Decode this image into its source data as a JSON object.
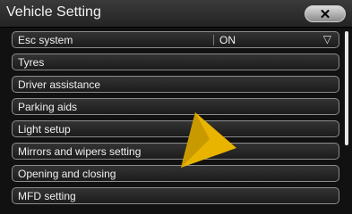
{
  "window": {
    "title": "Vehicle Setting",
    "close_symbol": "✕"
  },
  "esc": {
    "label": "Esc system",
    "value": "ON",
    "dropdown_symbol": "▽"
  },
  "items": [
    {
      "label": "Tyres"
    },
    {
      "label": "Driver assistance"
    },
    {
      "label": "Parking aids"
    },
    {
      "label": "Light setup"
    },
    {
      "label": "Mirrors and wipers setting"
    },
    {
      "label": "Opening and closing"
    },
    {
      "label": "MFD setting"
    }
  ],
  "colors": {
    "accent": "#e8b400",
    "row_border": "#8c8c8c"
  },
  "icons": {
    "pointer": "arrow-pointer-icon",
    "close": "close-icon"
  }
}
